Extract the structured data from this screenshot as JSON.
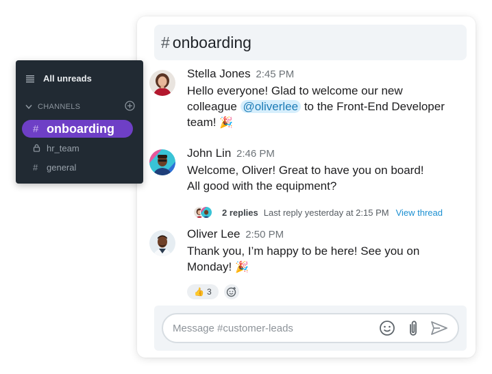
{
  "channel": {
    "hash": "#",
    "name": "onboarding"
  },
  "messages": [
    {
      "author": "Stella Jones",
      "time": "2:45 PM",
      "text_line1": "Hello everyone! Glad to welcome our new",
      "text_pre_mention": "colleague ",
      "mention": "@oliverlee",
      "text_post_mention": " to the Front-End Developer",
      "text_line3": "team!",
      "emoji": "🎉"
    },
    {
      "author": "John Lin",
      "time": "2:46 PM",
      "text_line1": "Welcome, Oliver! Great to have you on board!",
      "text_line2": "All good with the equipment?"
    },
    {
      "author": "Oliver Lee",
      "time": "2:50 PM",
      "text_line1": "Thank you, I’m happy to be here! See you on",
      "text_line2": "Monday!",
      "emoji": "🎉"
    }
  ],
  "thread": {
    "replies": "2 replies",
    "last_reply": "Last reply yesterday at 2:15 PM",
    "view_label": "View thread"
  },
  "reaction": {
    "emoji": "👍",
    "count": "3"
  },
  "composer": {
    "placeholder": "Message #customer-leads"
  },
  "sidebar": {
    "all_unreads": "All unreads",
    "section": "CHANNELS",
    "items": [
      {
        "prefix": "#",
        "label": "onboarding",
        "active": true
      },
      {
        "prefix": "lock",
        "label": "hr_team"
      },
      {
        "prefix": "#",
        "label": "general"
      }
    ]
  },
  "colors": {
    "accent": "#6e3fc6",
    "sidebar_bg": "#212a33",
    "link": "#1b8fd1",
    "mention_bg": "#d6eefc"
  }
}
